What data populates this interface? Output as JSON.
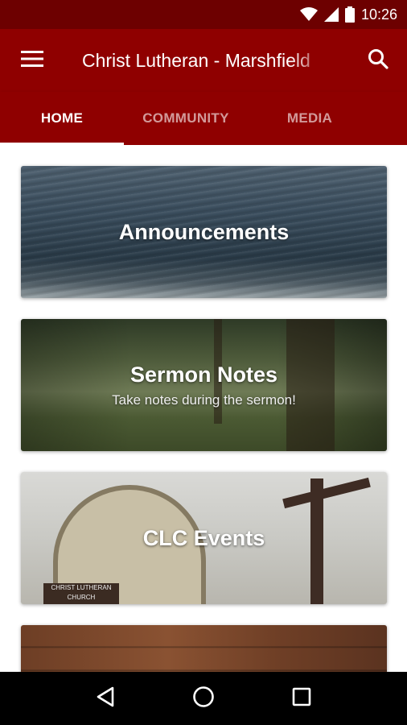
{
  "status_bar": {
    "time": "10:26",
    "icons": [
      "wifi-icon",
      "cell-signal-icon",
      "battery-icon"
    ]
  },
  "app_bar": {
    "title": "Christ Lutheran - Marshfield",
    "menu_icon": "hamburger-menu-icon",
    "search_icon": "search-icon"
  },
  "tabs": [
    {
      "label": "HOME",
      "active": true
    },
    {
      "label": "COMMUNITY",
      "active": false
    },
    {
      "label": "MEDIA",
      "active": false
    }
  ],
  "cards": [
    {
      "title": "Announcements",
      "subtitle": ""
    },
    {
      "title": "Sermon Notes",
      "subtitle": "Take notes during the sermon!"
    },
    {
      "title": "CLC Events",
      "subtitle": ""
    },
    {
      "title": "",
      "subtitle": ""
    }
  ],
  "church_sign": "CHRIST LUTHERAN CHURCH",
  "nav_bar": {
    "back_icon": "back-triangle-icon",
    "home_icon": "home-circle-icon",
    "recents_icon": "recents-square-icon"
  },
  "colors": {
    "status_bar": "#6d0000",
    "primary": "#8f0000",
    "tab_indicator": "#ffffff",
    "nav_bar": "#000000"
  }
}
